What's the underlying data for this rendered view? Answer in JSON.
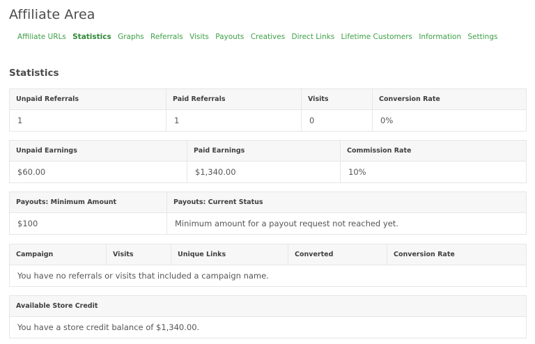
{
  "page_title": "Affiliate Area",
  "tabs": [
    {
      "label": "Affiliate URLs",
      "active": false
    },
    {
      "label": "Statistics",
      "active": true
    },
    {
      "label": "Graphs",
      "active": false
    },
    {
      "label": "Referrals",
      "active": false
    },
    {
      "label": "Visits",
      "active": false
    },
    {
      "label": "Payouts",
      "active": false
    },
    {
      "label": "Creatives",
      "active": false
    },
    {
      "label": "Direct Links",
      "active": false
    },
    {
      "label": "Lifetime Customers",
      "active": false
    },
    {
      "label": "Information",
      "active": false
    },
    {
      "label": "Settings",
      "active": false
    }
  ],
  "section_title": "Statistics",
  "referrals_table": {
    "headers": [
      "Unpaid Referrals",
      "Paid Referrals",
      "Visits",
      "Conversion Rate"
    ],
    "values": [
      "1",
      "1",
      "0",
      "0%"
    ]
  },
  "earnings_table": {
    "headers": [
      "Unpaid Earnings",
      "Paid Earnings",
      "Commission Rate"
    ],
    "values": [
      "$60.00",
      "$1,340.00",
      "10%"
    ]
  },
  "payouts_table": {
    "headers": [
      "Payouts: Minimum Amount",
      "Payouts: Current Status"
    ],
    "values": [
      "$100",
      "Minimum amount for a payout request not reached yet."
    ]
  },
  "campaign_table": {
    "headers": [
      "Campaign",
      "Visits",
      "Unique Links",
      "Converted",
      "Conversion Rate"
    ],
    "empty_message": "You have no referrals or visits that included a campaign name."
  },
  "store_credit_table": {
    "header": "Available Store Credit",
    "message": "You have a store credit balance of $1,340.00."
  },
  "colors": {
    "link": "#3da046",
    "error": "#d9332a",
    "header_bg": "#f7f7f7",
    "border": "#e6e6e6"
  }
}
